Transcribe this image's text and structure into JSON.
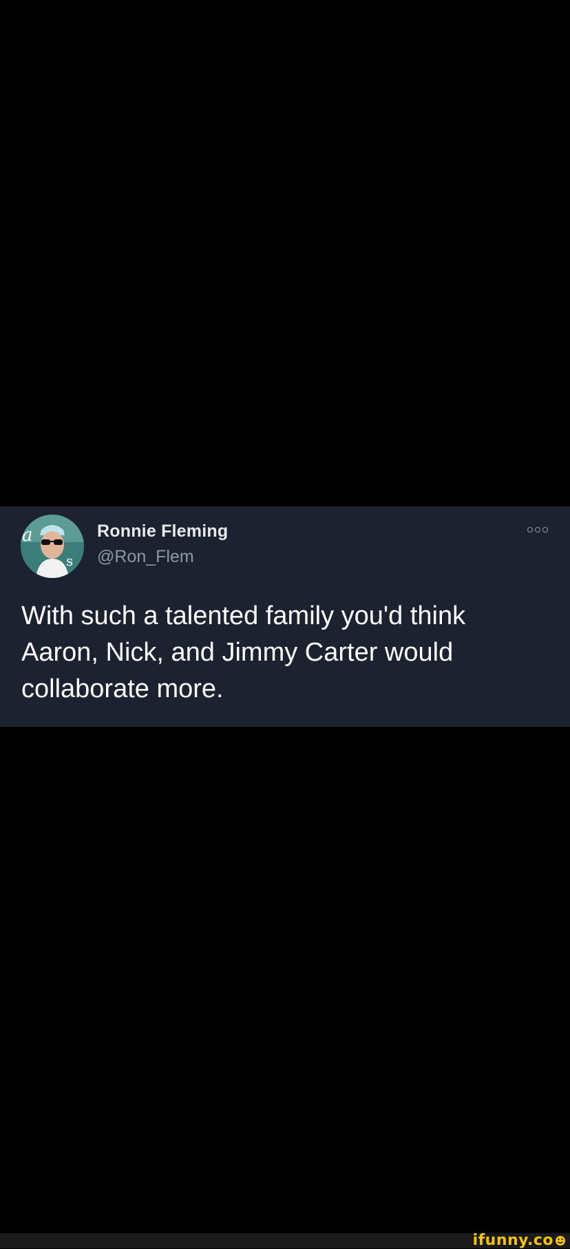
{
  "tweet": {
    "author": {
      "display_name": "Ronnie Fleming",
      "handle": "@Ron_Flem"
    },
    "text": "With such a talented family you'd think Aaron, Nick, and Jimmy Carter would collaborate more.",
    "more_icon": "more-options-icon"
  },
  "watermark": {
    "text": "ifunny.co",
    "color": "#f7c400"
  },
  "colors": {
    "background": "#000000",
    "card": "#1c2230",
    "name": "#e7e9ea",
    "handle": "#8b98a5",
    "text": "#ffffff"
  }
}
